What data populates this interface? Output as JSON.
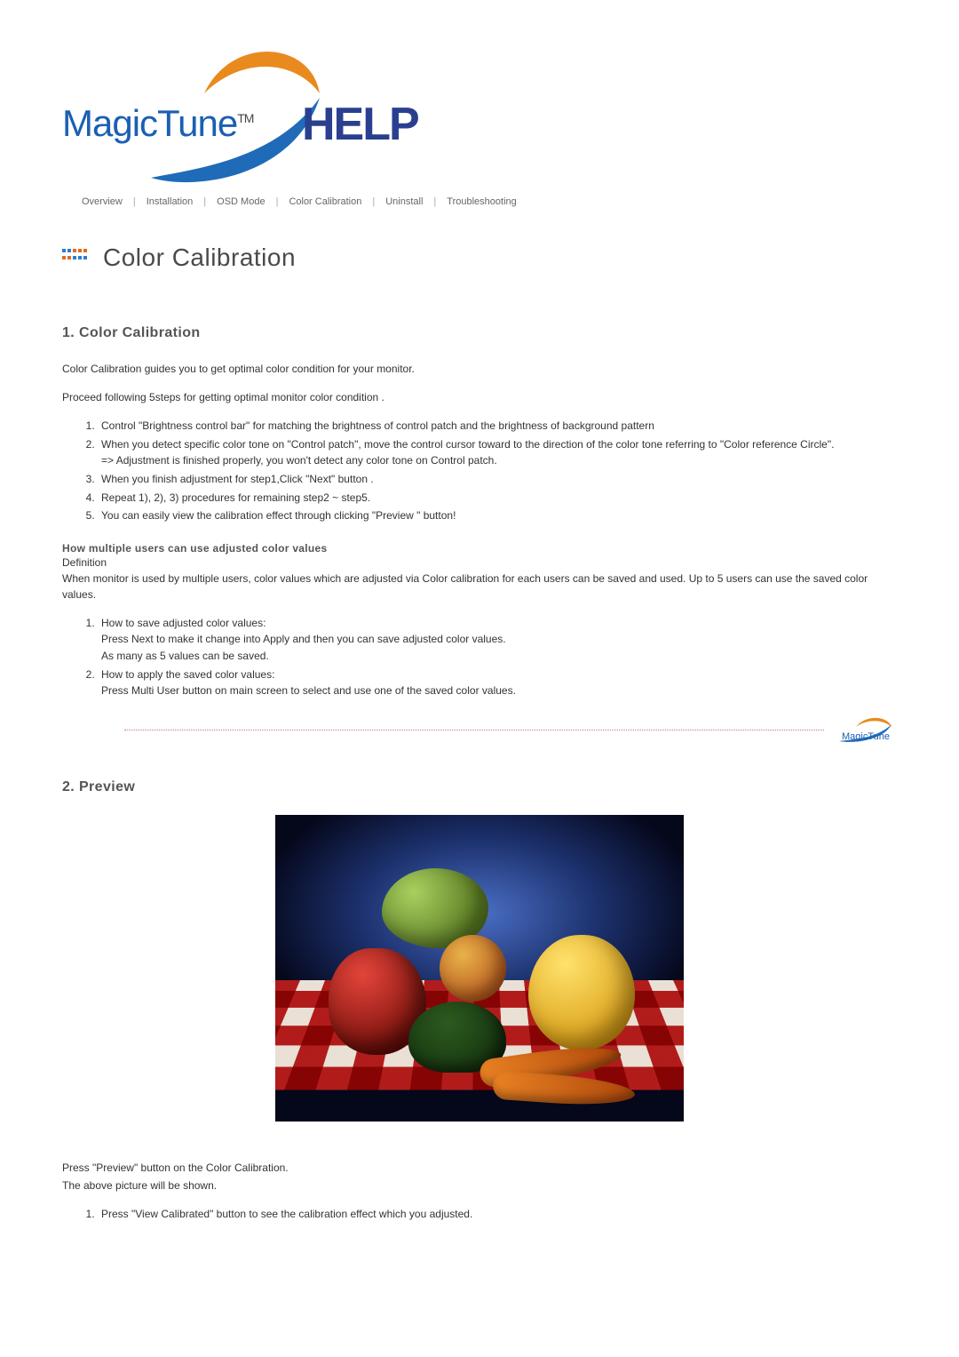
{
  "logo": {
    "brand": "MagicTune",
    "tm": "TM",
    "help": "HELP"
  },
  "nav": {
    "items": [
      "Overview",
      "Installation",
      "OSD Mode",
      "Color Calibration",
      "Uninstall",
      "Troubleshooting"
    ]
  },
  "page_title": "Color Calibration",
  "section1": {
    "title": "1. Color Calibration",
    "intro1": "Color Calibration guides you to get optimal color condition for your monitor.",
    "intro2": "Proceed following 5steps for getting optimal monitor color condition .",
    "steps": [
      "Control \"Brightness control bar\" for matching the brightness of control patch and the brightness of background pattern",
      "When you detect specific color tone on \"Control patch\", move the control cursor toward to the direction of the color tone referring to \"Color reference Circle\".\n=> Adjustment is finished properly, you won't detect any color tone on Control patch.",
      "When you finish adjustment for step1,Click \"Next\" button .",
      "Repeat 1), 2), 3) procedures for remaining step2 ~ step5.",
      "You can easily view the calibration effect through clicking \"Preview \" button!"
    ],
    "multi_heading": "How multiple users can use adjusted color values",
    "definition_label": "Definition",
    "multi_body": "When monitor is used by multiple users, color values which are adjusted via Color calibration for each users can be saved and used. Up to 5 users can use the saved color values.",
    "multi_steps": [
      "How to save adjusted color values:\nPress Next to make it change into Apply and then you can save adjusted color values.\nAs many as 5 values can be saved.",
      "How to apply the saved color values:\nPress Multi User button on main screen to select and use one of the saved color values."
    ]
  },
  "section2": {
    "title": "2. Preview",
    "caption1": "Press \"Preview\" button on the Color Calibration.",
    "caption2": "The above picture will be shown.",
    "steps": [
      "Press \"View Calibrated\" button to see the calibration effect which you adjusted."
    ]
  },
  "mini_logo": "MagicTune"
}
